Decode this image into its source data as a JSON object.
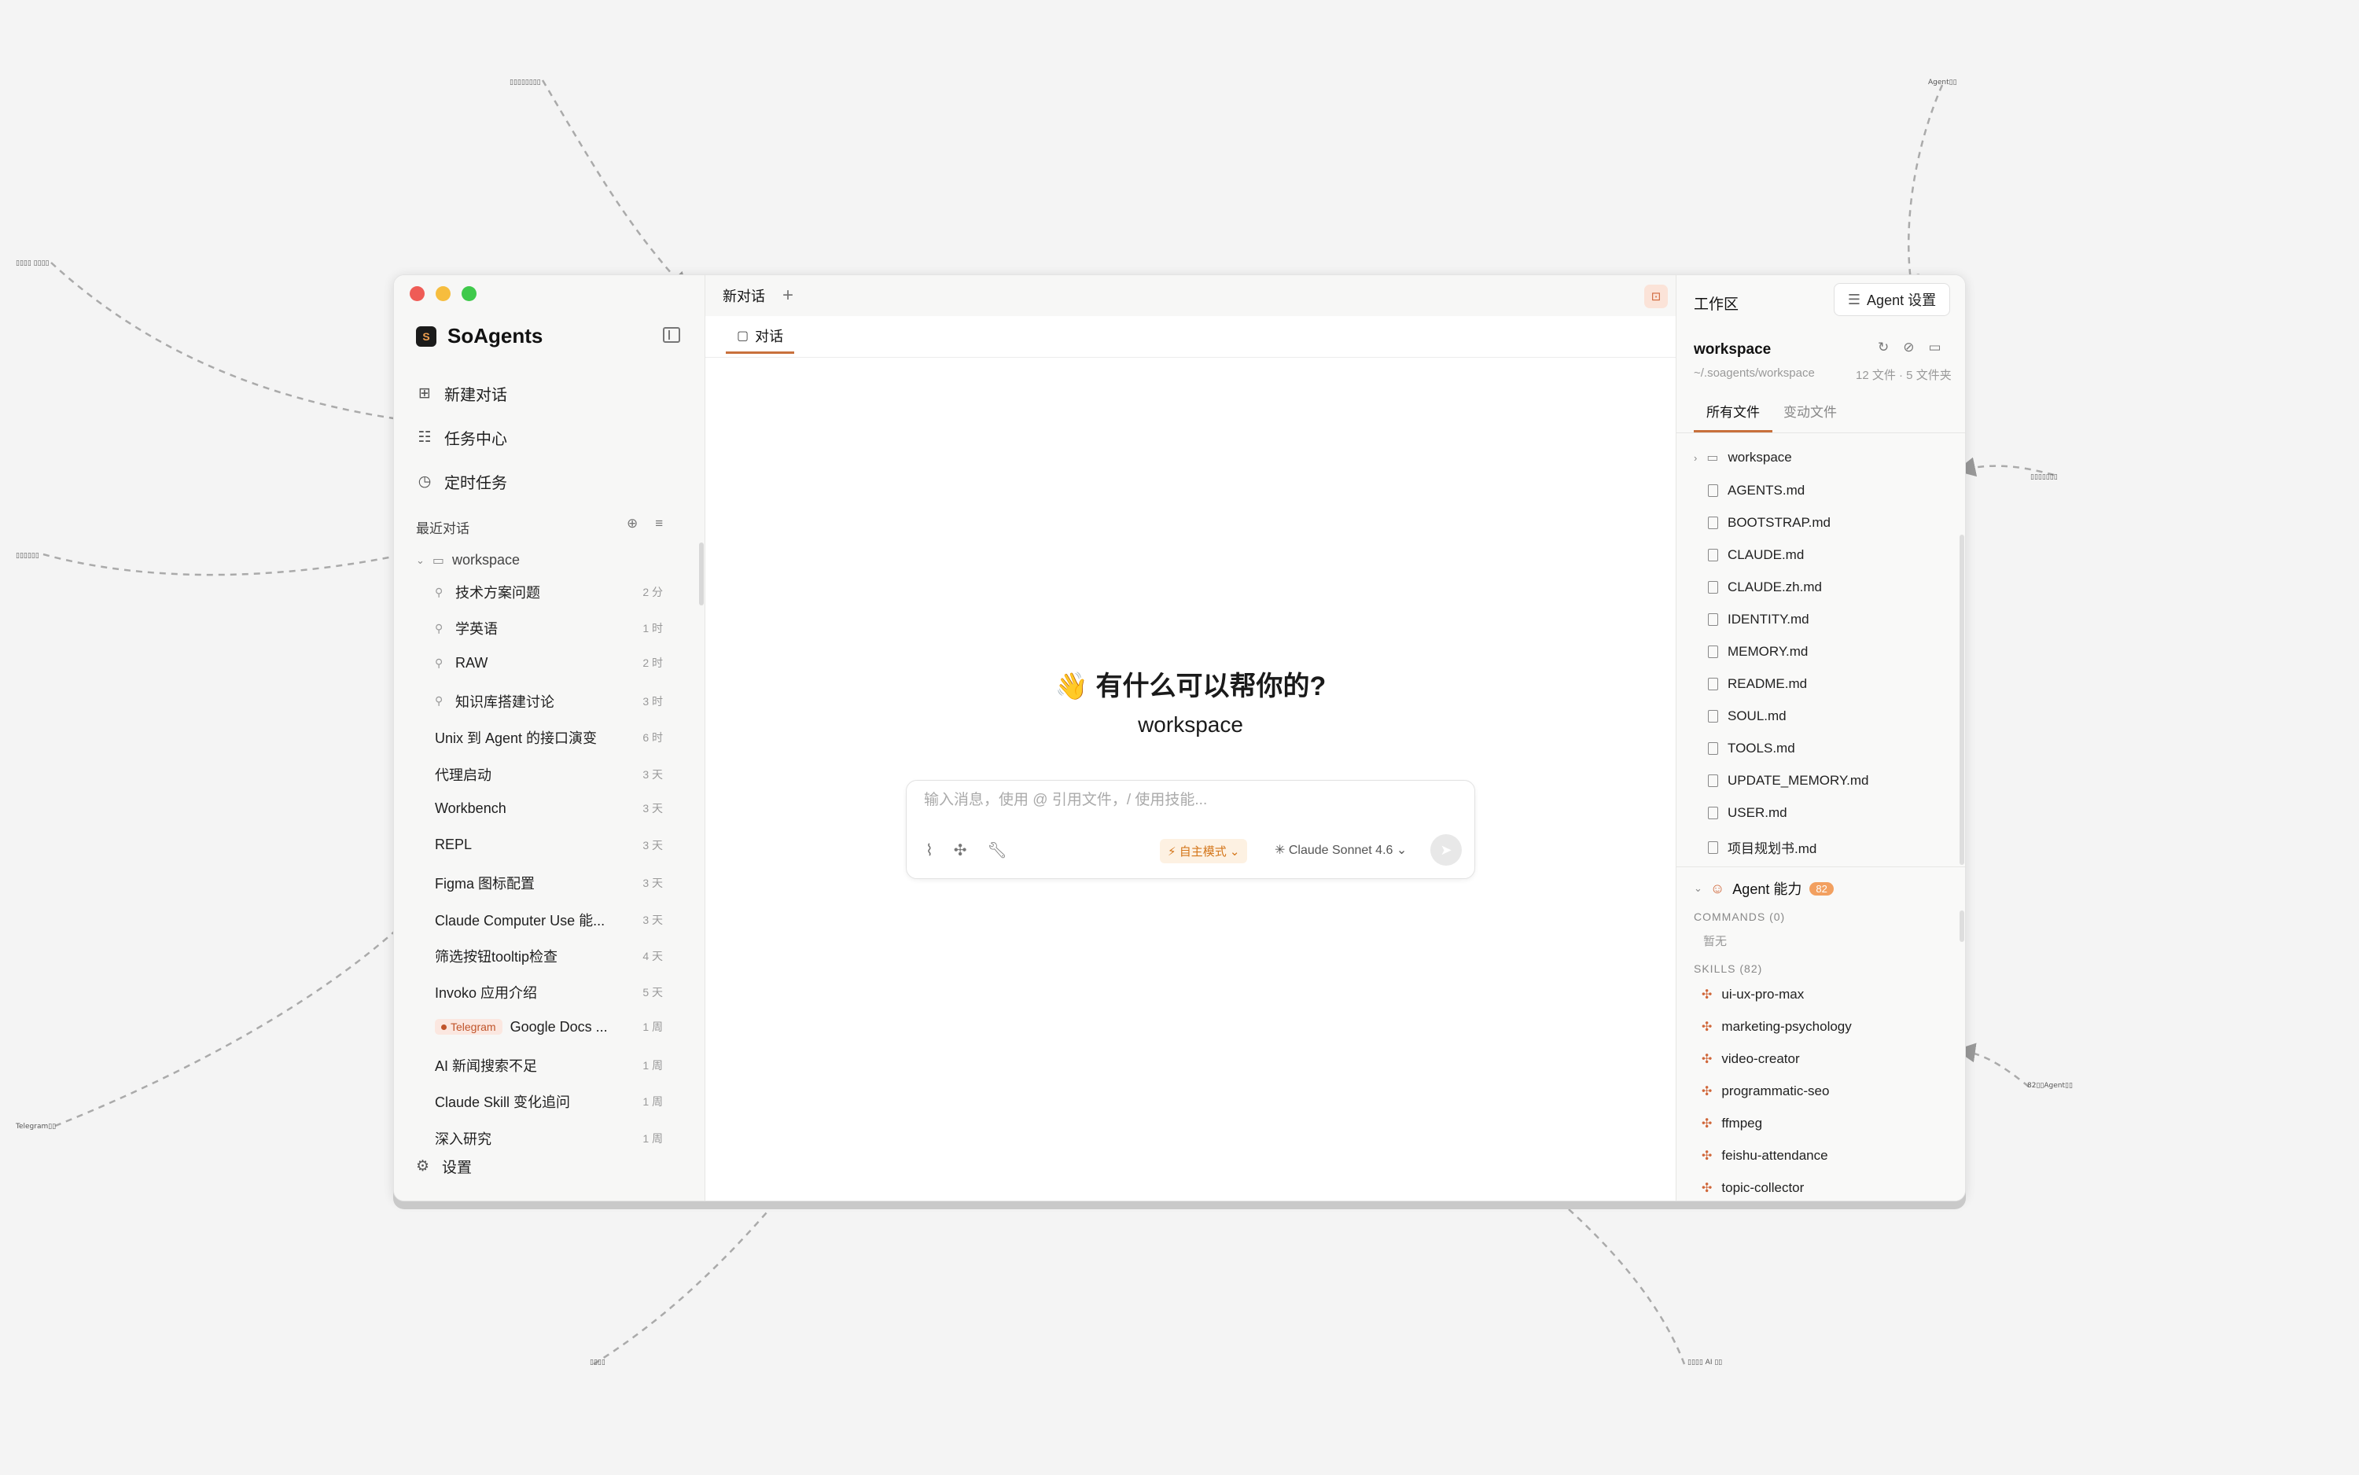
{
  "app": {
    "name": "SoAgents"
  },
  "sidebar": {
    "nav": [
      {
        "label": "新建对话",
        "icon": "new-chat-icon"
      },
      {
        "label": "任务中心",
        "icon": "task-center-icon"
      },
      {
        "label": "定时任务",
        "icon": "clock-icon"
      }
    ],
    "section_title": "最近对话",
    "folder": "workspace",
    "conversations": [
      {
        "title": "技术方案问题",
        "time": "2 分",
        "pinned": true
      },
      {
        "title": "学英语",
        "time": "1 时",
        "pinned": true
      },
      {
        "title": "RAW",
        "time": "2 时",
        "pinned": true
      },
      {
        "title": "知识库搭建讨论",
        "time": "3 时",
        "pinned": true
      },
      {
        "title": "Unix 到 Agent 的接口演变",
        "time": "6 时"
      },
      {
        "title": "代理启动",
        "time": "3 天"
      },
      {
        "title": "Workbench",
        "time": "3 天"
      },
      {
        "title": "REPL",
        "time": "3 天"
      },
      {
        "title": "Figma 图标配置",
        "time": "3 天"
      },
      {
        "title": "Claude Computer Use 能...",
        "time": "3 天"
      },
      {
        "title": "筛选按钮tooltip检查",
        "time": "4 天"
      },
      {
        "title": "Invoko 应用介绍",
        "time": "5 天"
      },
      {
        "title": "Google Docs ...",
        "time": "1 周",
        "badge": "Telegram"
      },
      {
        "title": "AI 新闻搜索不足",
        "time": "1 周"
      },
      {
        "title": "Claude Skill 变化追问",
        "time": "1 周"
      },
      {
        "title": "深入研究",
        "time": "1 周"
      }
    ],
    "settings_label": "设置"
  },
  "main": {
    "tab_label": "新对话",
    "subtab_label": "对话",
    "greeting": "👋 有什么可以帮你的?",
    "workspace_name": "workspace",
    "composer": {
      "placeholder": "输入消息，使用 @ 引用文件，/ 使用技能...",
      "mode_label": "自主模式",
      "model_label": "Claude Sonnet 4.6"
    }
  },
  "right_panel": {
    "title": "工作区",
    "agent_settings_label": "Agent 设置",
    "workspace": "workspace",
    "path": "~/.soagents/workspace",
    "counts": "12 文件 · 5 文件夹",
    "tabs": [
      "所有文件",
      "变动文件"
    ],
    "folder": "workspace",
    "files": [
      "AGENTS.md",
      "BOOTSTRAP.md",
      "CLAUDE.md",
      "CLAUDE.zh.md",
      "IDENTITY.md",
      "MEMORY.md",
      "README.md",
      "SOUL.md",
      "TOOLS.md",
      "UPDATE_MEMORY.md",
      "USER.md",
      "项目规划书.md"
    ],
    "agent_ability": {
      "label": "Agent 能力",
      "count": "82"
    },
    "commands_label": "COMMANDS (0)",
    "commands_empty": "暂无",
    "skills_label": "SKILLS (82)",
    "skills": [
      "ui-ux-pro-max",
      "marketing-psychology",
      "video-creator",
      "programmatic-seo",
      "ffmpeg",
      "feishu-attendance",
      "topic-collector"
    ]
  },
  "colors": {
    "accent": "#c8703c",
    "close": "#ef5c56",
    "minimize": "#f6bd3e",
    "maximize": "#3fc94b"
  }
}
